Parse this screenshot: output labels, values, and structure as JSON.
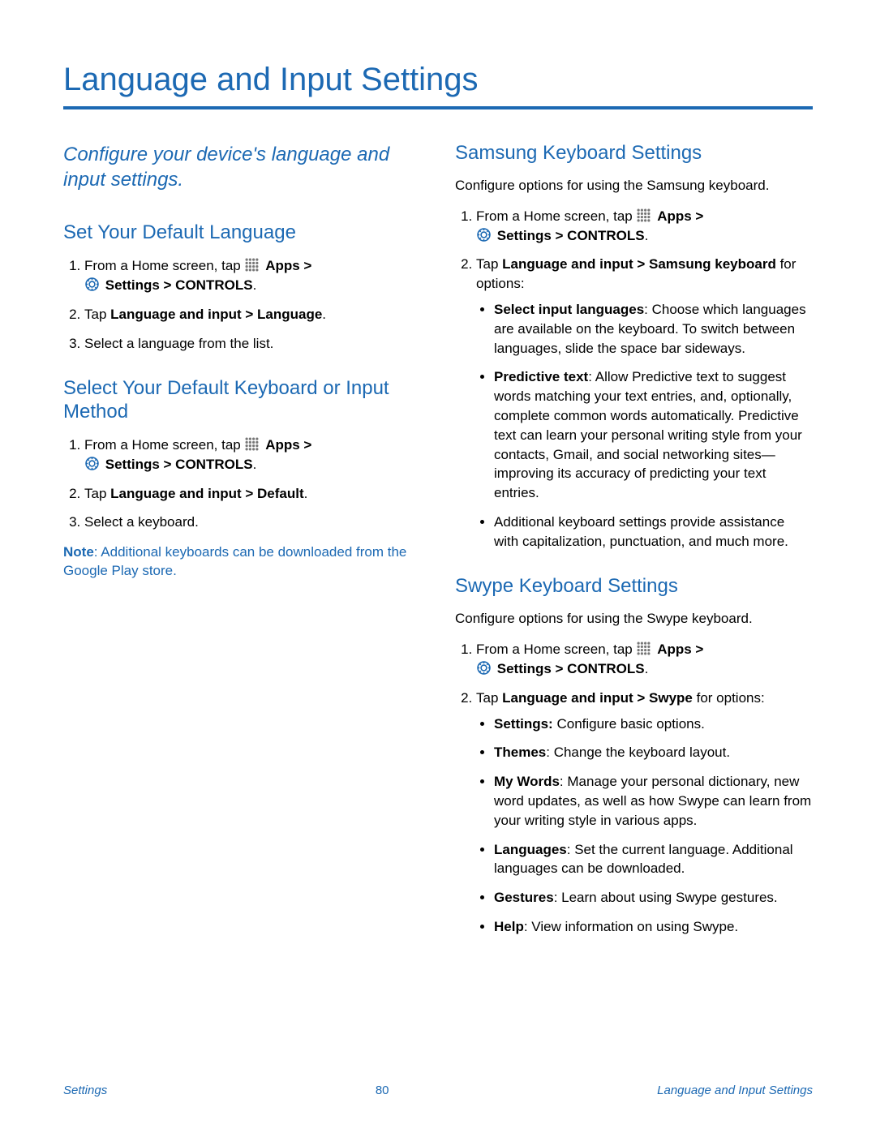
{
  "page": {
    "title": "Language and Input Settings"
  },
  "intro": "Configure your device's language and input settings.",
  "common": {
    "from_home_prefix": "From a Home screen, tap ",
    "apps_label": "Apps > ",
    "settings_controls": "Settings > CONTROLS",
    "period": "."
  },
  "left": {
    "s1": {
      "heading": "Set Your Default Language",
      "step2_pre": "Tap ",
      "step2_strong": "Language and input > Language",
      "step2_post": ".",
      "step3": "Select a language from the list."
    },
    "s2": {
      "heading": "Select Your Default Keyboard or Input Method",
      "step2_pre": "Tap ",
      "step2_strong": "Language and input > Default",
      "step2_post": ".",
      "step3": "Select a keyboard.",
      "note_label": "Note",
      "note_text": ": Additional keyboards can be downloaded from the Google Play store."
    }
  },
  "right": {
    "samsung": {
      "heading": "Samsung Keyboard Settings",
      "lead": "Configure options for using the Samsung keyboard.",
      "step2_pre": "Tap ",
      "step2_strong": "Language and input > Samsung keyboard",
      "step2_post": " for options:",
      "b1_strong": "Select input languages",
      "b1_text": ": Choose which languages are available on the keyboard. To switch between languages, slide the space bar sideways.",
      "b2_strong": "Predictive text",
      "b2_text": ": Allow Predictive text to suggest words matching your text entries, and, optionally, complete common words automatically. Predictive text can learn your personal writing style from your contacts, Gmail, and social networking sites—improving its accuracy of predicting your text entries.",
      "b3_text": "Additional keyboard settings provide assistance with capitalization, punctuation, and much more."
    },
    "swype": {
      "heading": "Swype Keyboard Settings",
      "lead": "Configure options for using the Swype keyboard.",
      "step2_pre": "Tap ",
      "step2_strong": "Language and input > Swype",
      "step2_post": " for options:",
      "b1_strong": "Settings:",
      "b1_text": " Configure basic options.",
      "b2_strong": "Themes",
      "b2_text": ": Change the keyboard layout.",
      "b3_strong": "My Words",
      "b3_text": ": Manage your personal dictionary, new word updates, as well as how Swype can learn from your writing style in various apps.",
      "b4_strong": "Languages",
      "b4_text": ": Set the current language. Additional languages can be downloaded.",
      "b5_strong": "Gestures",
      "b5_text": ": Learn about using Swype gestures.",
      "b6_strong": "Help",
      "b6_text": ": View information on using Swype."
    }
  },
  "footer": {
    "left": "Settings",
    "center": "80",
    "right": "Language and Input Settings"
  }
}
